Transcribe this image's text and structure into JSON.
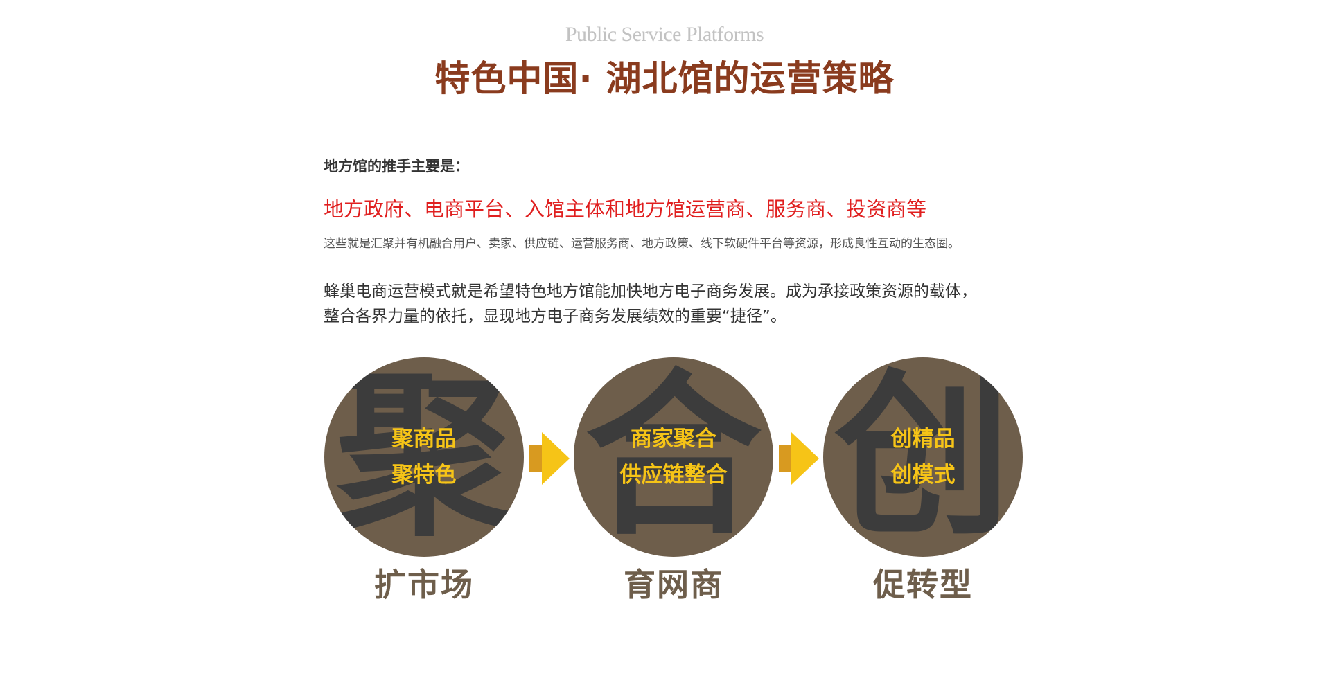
{
  "header": {
    "subtitle_en": "Public Service Platforms",
    "title": "特色中国· 湖北馆的运营策略"
  },
  "content": {
    "intro": "地方馆的推手主要是：",
    "players": "地方政府、电商平台、入馆主体和地方馆运营商、服务商、投资商等",
    "description": "这些就是汇聚并有机融合用户、卖家、供应链、运营服务商、地方政策、线下软硬件平台等资源，形成良性互动的生态圈。",
    "paragraph_line1": "蜂巢电商运营模式就是希望特色地方馆能加快地方电子商务发展。成为承接政策资源的载体，",
    "paragraph_line2": "整合各界力量的依托，显现地方电子商务发展绩效的重要“捷径”。"
  },
  "steps": [
    {
      "big_char": "聚",
      "line1": "聚商品",
      "line2": "聚特色",
      "caption": "扩市场"
    },
    {
      "big_char": "合",
      "line1": "商家聚合",
      "line2": "供应链整合",
      "caption": "育网商"
    },
    {
      "big_char": "创",
      "line1": "创精品",
      "line2": "创模式",
      "caption": "促转型"
    }
  ],
  "colors": {
    "title": "#8a3b1e",
    "players": "#e01f1f",
    "circle": "#6e5e4b",
    "big_char": "#3c3c3c",
    "circle_text": "#f6c417",
    "arrow_light": "#f6c417",
    "arrow_dark": "#d89a20"
  }
}
